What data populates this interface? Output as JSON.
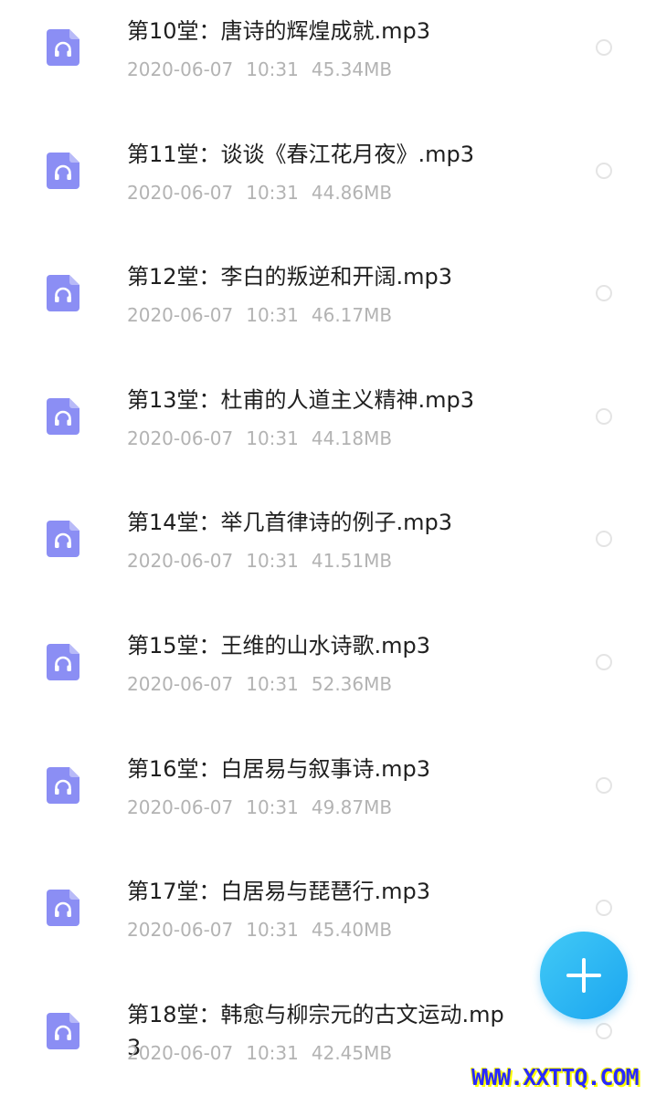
{
  "files": [
    {
      "name": "第10堂：唐诗的辉煌成就.mp3",
      "date": "2020-06-07",
      "time": "10:31",
      "size": "45.34MB"
    },
    {
      "name": "第11堂：谈谈《春江花月夜》.mp3",
      "date": "2020-06-07",
      "time": "10:31",
      "size": "44.86MB"
    },
    {
      "name": "第12堂：李白的叛逆和开阔.mp3",
      "date": "2020-06-07",
      "time": "10:31",
      "size": "46.17MB"
    },
    {
      "name": "第13堂：杜甫的人道主义精神.mp3",
      "date": "2020-06-07",
      "time": "10:31",
      "size": "44.18MB"
    },
    {
      "name": "第14堂：举几首律诗的例子.mp3",
      "date": "2020-06-07",
      "time": "10:31",
      "size": "41.51MB"
    },
    {
      "name": "第15堂：王维的山水诗歌.mp3",
      "date": "2020-06-07",
      "time": "10:31",
      "size": "52.36MB"
    },
    {
      "name": "第16堂：白居易与叙事诗.mp3",
      "date": "2020-06-07",
      "time": "10:31",
      "size": "49.87MB"
    },
    {
      "name": "第17堂：白居易与琵琶行.mp3",
      "date": "2020-06-07",
      "time": "10:31",
      "size": "45.40MB"
    },
    {
      "name": "第18堂：韩愈与柳宗元的古文运动.mp3",
      "date": "2020-06-07",
      "time": "10:31",
      "size": "42.45MB"
    }
  ],
  "icons": {
    "file": "audio-file-icon",
    "radio": "radio-unchecked",
    "fab": "plus-icon"
  },
  "colors": {
    "icon_fill": "#8b8ef4",
    "icon_fold": "#b8baf8",
    "fab": "#26b0f2",
    "watermark_text": "#2a2aff",
    "watermark_shadow": "#ffff00"
  },
  "watermark": "WWW.XXTTQ.COM"
}
